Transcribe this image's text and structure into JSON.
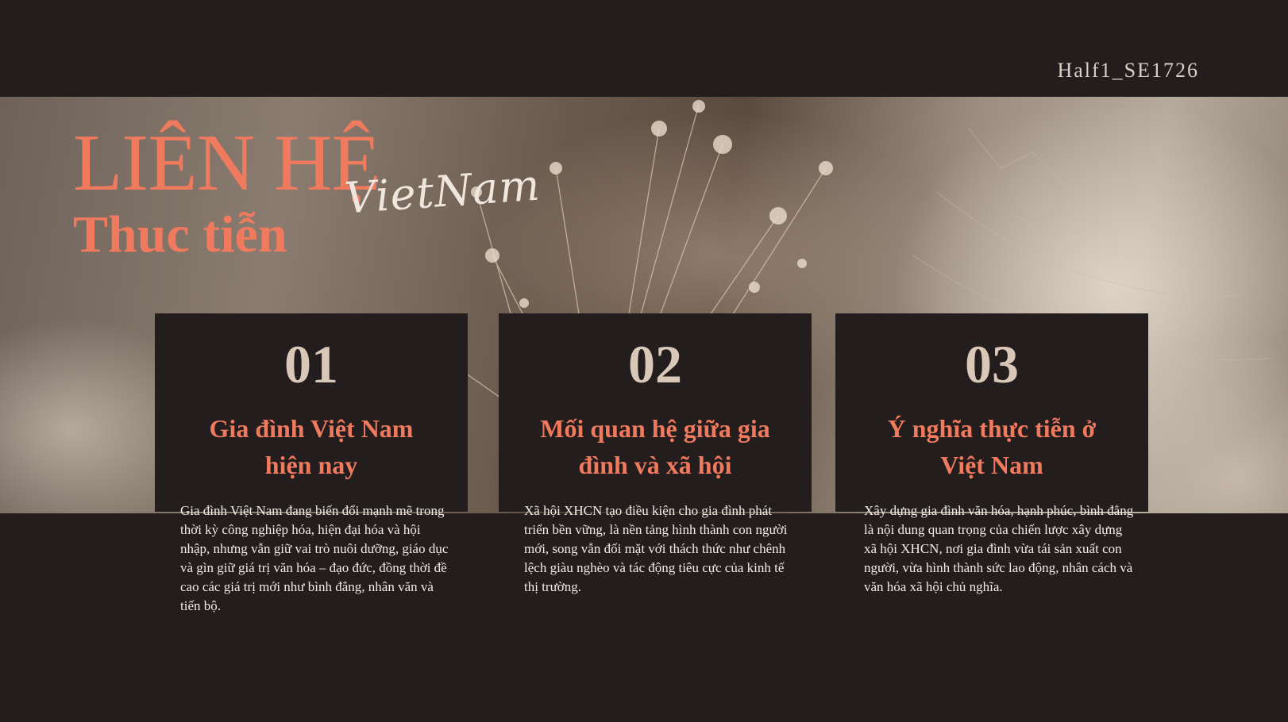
{
  "top_label": "Half1_SE1726",
  "title": {
    "line1": "LIÊN HỆ",
    "line2": "Thuc tiễn",
    "script": "VietNam"
  },
  "cards": [
    {
      "number": "01",
      "heading_line1": "Gia đình Việt Nam",
      "heading_line2": "hiện nay",
      "text": "Gia đình Việt Nam đang biến đổi mạnh mẽ trong thời kỳ công nghiệp hóa, hiện đại hóa và hội nhập, nhưng vẫn giữ vai trò nuôi dưỡng, giáo dục và gìn giữ giá trị văn hóa – đạo đức, đồng thời đề cao các giá trị mới như bình đẳng, nhân văn và tiến bộ."
    },
    {
      "number": "02",
      "heading_line1": "Mối quan hệ giữa gia",
      "heading_line2": "đình và xã hội",
      "text": "Xã hội XHCN tạo điều kiện cho gia đình phát triển bền vững, là nền tảng hình thành con người mới, song vẫn đối mặt với thách thức như chênh lệch giàu nghèo và tác động tiêu cực của kinh tế thị trường."
    },
    {
      "number": "03",
      "heading_line1": "Ý nghĩa thực tiễn ở",
      "heading_line2": "Việt Nam",
      "text": "Xây dựng gia đình văn hóa, hạnh phúc, bình đẳng là nội dung quan trọng của chiến lược xây dựng xã hội XHCN, nơi gia đình vừa tái sản xuất con người, vừa hình thành sức lao động, nhân cách và văn hóa xã hội chủ nghĩa."
    }
  ],
  "colors": {
    "background": "#231d1d",
    "accent": "#f07a5d",
    "number": "#d9c7b8",
    "body_text": "#f2ece6"
  }
}
